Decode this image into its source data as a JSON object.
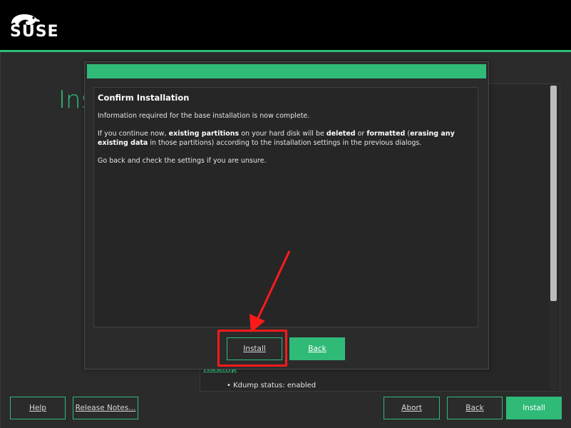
{
  "header": {
    "brand": "SUSE",
    "accent_color": "#30ba78"
  },
  "background": {
    "page_title": "Ins",
    "kdump_link": "Kdump",
    "kdump_status": "Kdump status: enabled"
  },
  "dialog": {
    "title": "Confirm Installation",
    "para1": "Information required for the base installation is now complete.",
    "para2_parts": [
      "If you continue now, ",
      "existing partitions",
      " on your hard disk will be ",
      "deleted",
      " or ",
      "formatted",
      " (",
      "erasing any existing data",
      " in those partitions) according to the installation settings in the previous dialogs."
    ],
    "para3": "Go back and check the settings if you are unsure.",
    "install_label": "Install",
    "back_label": "Back"
  },
  "footer": {
    "help_label": "Help",
    "release_notes_label": "Release Notes...",
    "abort_label": "Abort",
    "back_label": "Back",
    "install_label": "Install"
  },
  "icons": {
    "logo": "suse-chameleon-icon",
    "annotation": "red-arrow-annotation"
  }
}
